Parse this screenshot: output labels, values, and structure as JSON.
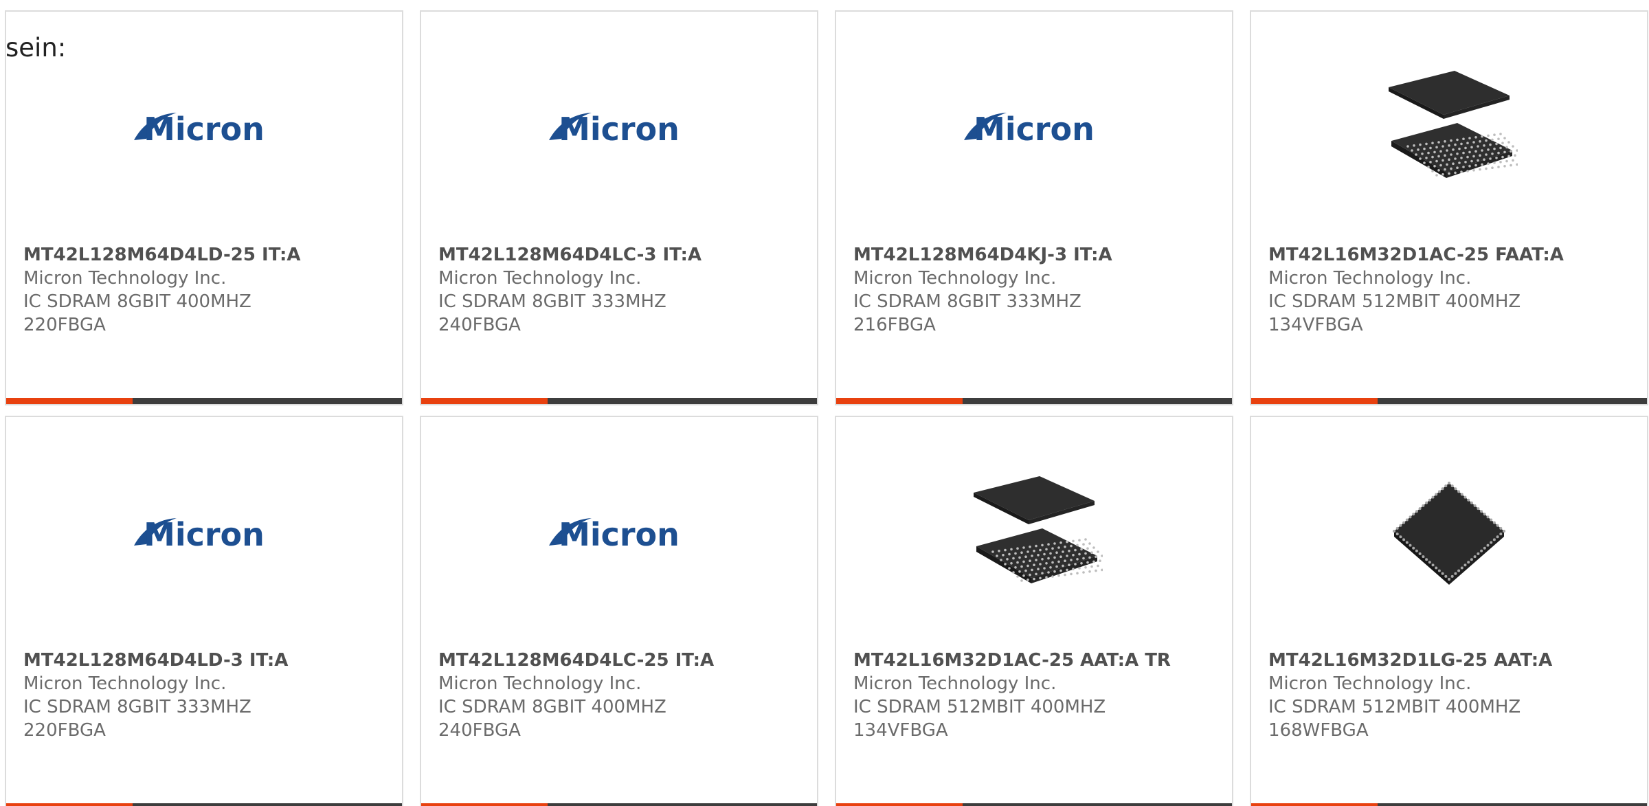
{
  "page": {
    "stray_label": "sein:"
  },
  "colors": {
    "accent": "#e8410f",
    "bar_base": "#3d3d3d",
    "logo_blue": "#1d4f91",
    "card_border": "#dcdcdc"
  },
  "products": [
    {
      "part_number": "MT42L128M64D4LD-25 IT:A",
      "manufacturer": "Micron Technology Inc.",
      "description_line1": "IC SDRAM 8GBIT 400MHZ",
      "description_line2": "220FBGA",
      "image_kind": "micron-logo",
      "image_text": "Micron"
    },
    {
      "part_number": "MT42L128M64D4LC-3 IT:A",
      "manufacturer": "Micron Technology Inc.",
      "description_line1": "IC SDRAM 8GBIT 333MHZ",
      "description_line2": "240FBGA",
      "image_kind": "micron-logo",
      "image_text": "Micron"
    },
    {
      "part_number": "MT42L128M64D4KJ-3 IT:A",
      "manufacturer": "Micron Technology Inc.",
      "description_line1": "IC SDRAM 8GBIT 333MHZ",
      "description_line2": "216FBGA",
      "image_kind": "micron-logo",
      "image_text": "Micron"
    },
    {
      "part_number": "MT42L16M32D1AC-25 FAAT:A",
      "manufacturer": "Micron Technology Inc.",
      "description_line1": "IC SDRAM 512MBIT 400MHZ",
      "description_line2": "134VFBGA",
      "image_kind": "bga-chip-pair"
    },
    {
      "part_number": "MT42L128M64D4LD-3 IT:A",
      "manufacturer": "Micron Technology Inc.",
      "description_line1": "IC SDRAM 8GBIT 333MHZ",
      "description_line2": "220FBGA",
      "image_kind": "micron-logo",
      "image_text": "Micron"
    },
    {
      "part_number": "MT42L128M64D4LC-25 IT:A",
      "manufacturer": "Micron Technology Inc.",
      "description_line1": "IC SDRAM 8GBIT 400MHZ",
      "description_line2": "240FBGA",
      "image_kind": "micron-logo",
      "image_text": "Micron"
    },
    {
      "part_number": "MT42L16M32D1AC-25 AAT:A TR",
      "manufacturer": "Micron Technology Inc.",
      "description_line1": "IC SDRAM 512MBIT 400MHZ",
      "description_line2": "134VFBGA",
      "image_kind": "bga-chip-pair"
    },
    {
      "part_number": "MT42L16M32D1LG-25 AAT:A",
      "manufacturer": "Micron Technology Inc.",
      "description_line1": "IC SDRAM 512MBIT 400MHZ",
      "description_line2": "168WFBGA",
      "image_kind": "bga-chip-single"
    }
  ]
}
